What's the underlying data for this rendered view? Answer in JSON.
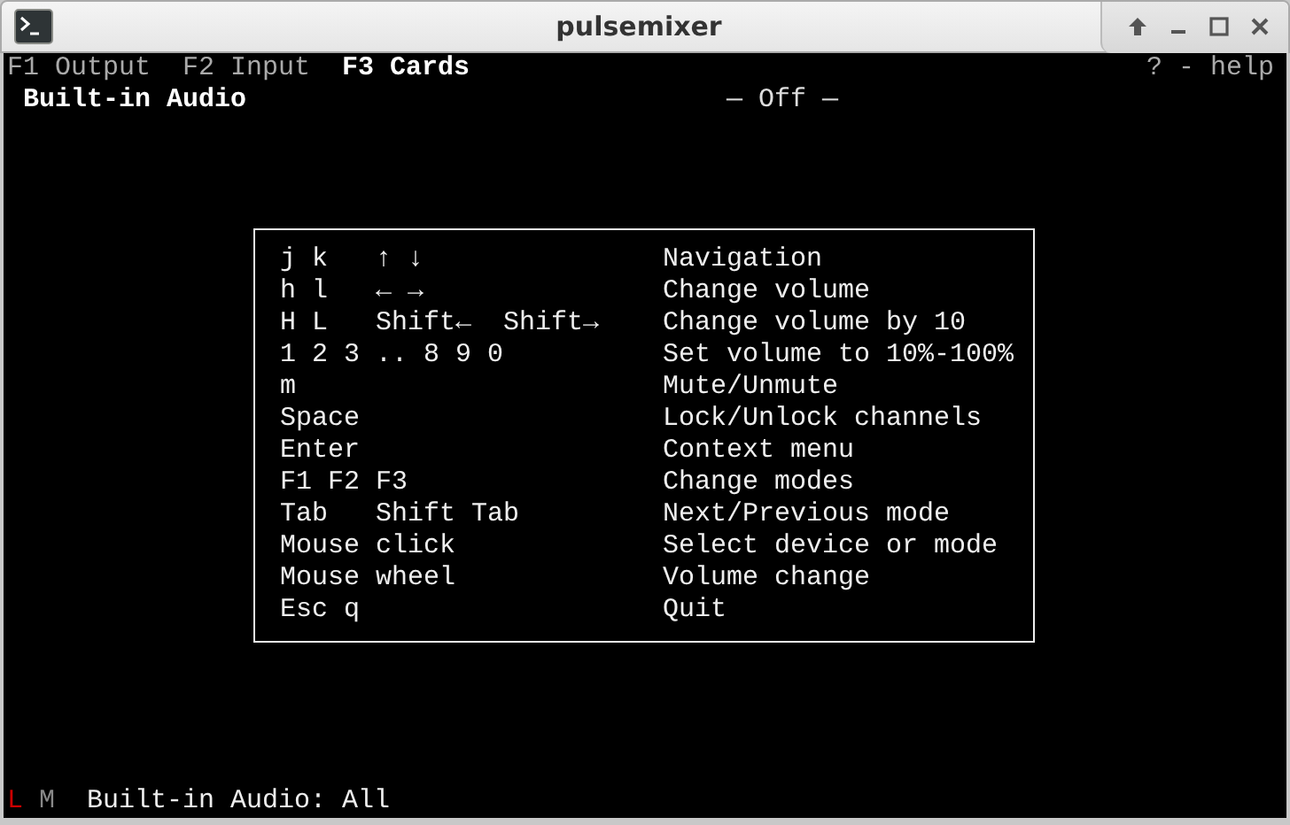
{
  "window": {
    "title": "pulsemixer"
  },
  "tabs": [
    {
      "label": "F1 Output",
      "selected": false
    },
    {
      "label": "F2 Input",
      "selected": false
    },
    {
      "label": "F3 Cards",
      "selected": true
    }
  ],
  "help_hint": "? - help",
  "card": {
    "name": "Built-in Audio",
    "profile": "— Off —"
  },
  "help": [
    {
      "keys": "j k   ↑ ↓",
      "action": "Navigation"
    },
    {
      "keys": "h l   ← →",
      "action": "Change volume"
    },
    {
      "keys": "H L   Shift←  Shift→",
      "action": "Change volume by 10"
    },
    {
      "keys": "1 2 3 .. 8 9 0",
      "action": "Set volume to 10%-100%"
    },
    {
      "keys": "m",
      "action": "Mute/Unmute"
    },
    {
      "keys": "Space",
      "action": "Lock/Unlock channels"
    },
    {
      "keys": "Enter",
      "action": "Context menu"
    },
    {
      "keys": "F1 F2 F3",
      "action": "Change modes"
    },
    {
      "keys": "Tab   Shift Tab",
      "action": "Next/Previous mode"
    },
    {
      "keys": "Mouse click",
      "action": "Select device or mode"
    },
    {
      "keys": "Mouse wheel",
      "action": "Volume change"
    },
    {
      "keys": "Esc q",
      "action": "Quit"
    }
  ],
  "status_bar": {
    "flags": [
      {
        "label": "L",
        "on": true
      },
      {
        "label": "M",
        "on": false
      }
    ],
    "text": "Built-in Audio: All"
  }
}
